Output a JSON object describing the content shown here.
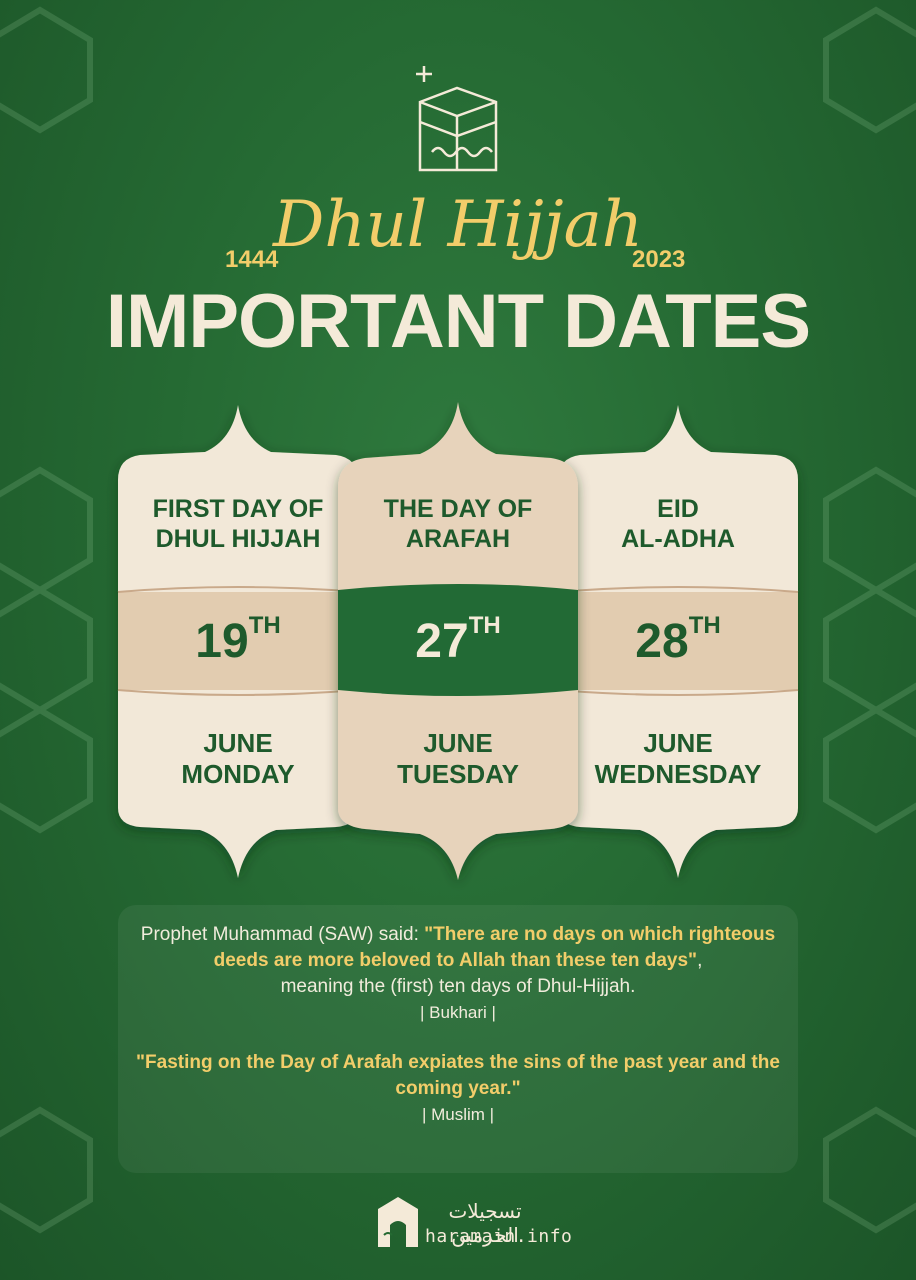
{
  "header": {
    "hijri_year": "1444",
    "gregorian_year": "2023",
    "script_title": "Dhul Hijjah",
    "main_title": "IMPORTANT DATES"
  },
  "cards": [
    {
      "heading_line1": "FIRST DAY OF",
      "heading_line2": "DHUL HIJJAH",
      "day": "19",
      "suffix": "TH",
      "month": "JUNE",
      "weekday": "MONDAY"
    },
    {
      "heading_line1": "THE DAY OF",
      "heading_line2": "ARAFAH",
      "day": "27",
      "suffix": "TH",
      "month": "JUNE",
      "weekday": "TUESDAY"
    },
    {
      "heading_line1": "EID",
      "heading_line2": "AL-ADHA",
      "day": "28",
      "suffix": "TH",
      "month": "JUNE",
      "weekday": "WEDNESDAY"
    }
  ],
  "quotes": {
    "intro": "Prophet Muhammad (SAW) said: ",
    "hadith1": "\"There are no days on which righteous deeds are more beloved to Allah than these ten days\"",
    "after1": ",",
    "explanation": "meaning the (first) ten days of Dhul-Hijjah.",
    "source1": "| Bukhari |",
    "hadith2": "\"Fasting on the Day of Arafah expiates the sins of the past year and the coming year.\"",
    "source2": "| Muslim |"
  },
  "footer": {
    "arabic": "تسجيلات الحرمين",
    "url": "haramain.info"
  },
  "colors": {
    "background": "#256a33",
    "gold": "#f2cd6a",
    "cream": "#f4ead8",
    "dark_green": "#1e5a2c",
    "tan": "#e2ccb0"
  },
  "icons": [
    "kaaba-icon",
    "sparkle-icon",
    "haramain-logo-icon"
  ]
}
